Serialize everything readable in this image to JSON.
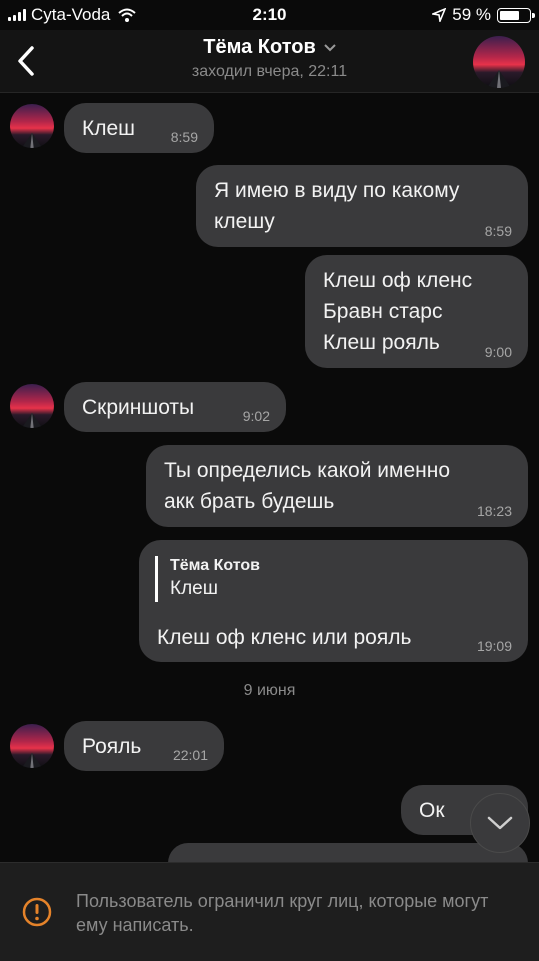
{
  "status_bar": {
    "carrier": "Cyta-Voda",
    "time": "2:10",
    "battery": "59 %",
    "battery_level": 0.59
  },
  "header": {
    "title": "Тёма Котов",
    "subtitle": "заходил вчера, 22:11"
  },
  "messages": [
    {
      "text": "Клеш",
      "time": "8:59"
    },
    {
      "text": "Я имею в виду по какому\nклешу",
      "time": "8:59"
    },
    {
      "text": "Клеш оф кленс\nБравн старс\nКлеш рояль",
      "time": "9:00"
    },
    {
      "text": "Скриншоты",
      "time": "9:02"
    },
    {
      "text": "Ты определись какой именно\nакк брать будешь",
      "time": "18:23"
    },
    {
      "reply_name": "Тёма Котов",
      "reply_text": "Клеш",
      "text": "Клеш оф кленс или рояль",
      "time": "19:09"
    },
    {
      "text": "Рояль",
      "time": "22:01"
    },
    {
      "text": "Ок"
    }
  ],
  "date_separator": "9 июня",
  "footer": {
    "notice": "Пользователь ограничил круг лиц, которые могут ему написать."
  },
  "colors": {
    "background": "#0a0a0a",
    "bubble": "#3a3a3c",
    "warning": "#e5832a"
  }
}
